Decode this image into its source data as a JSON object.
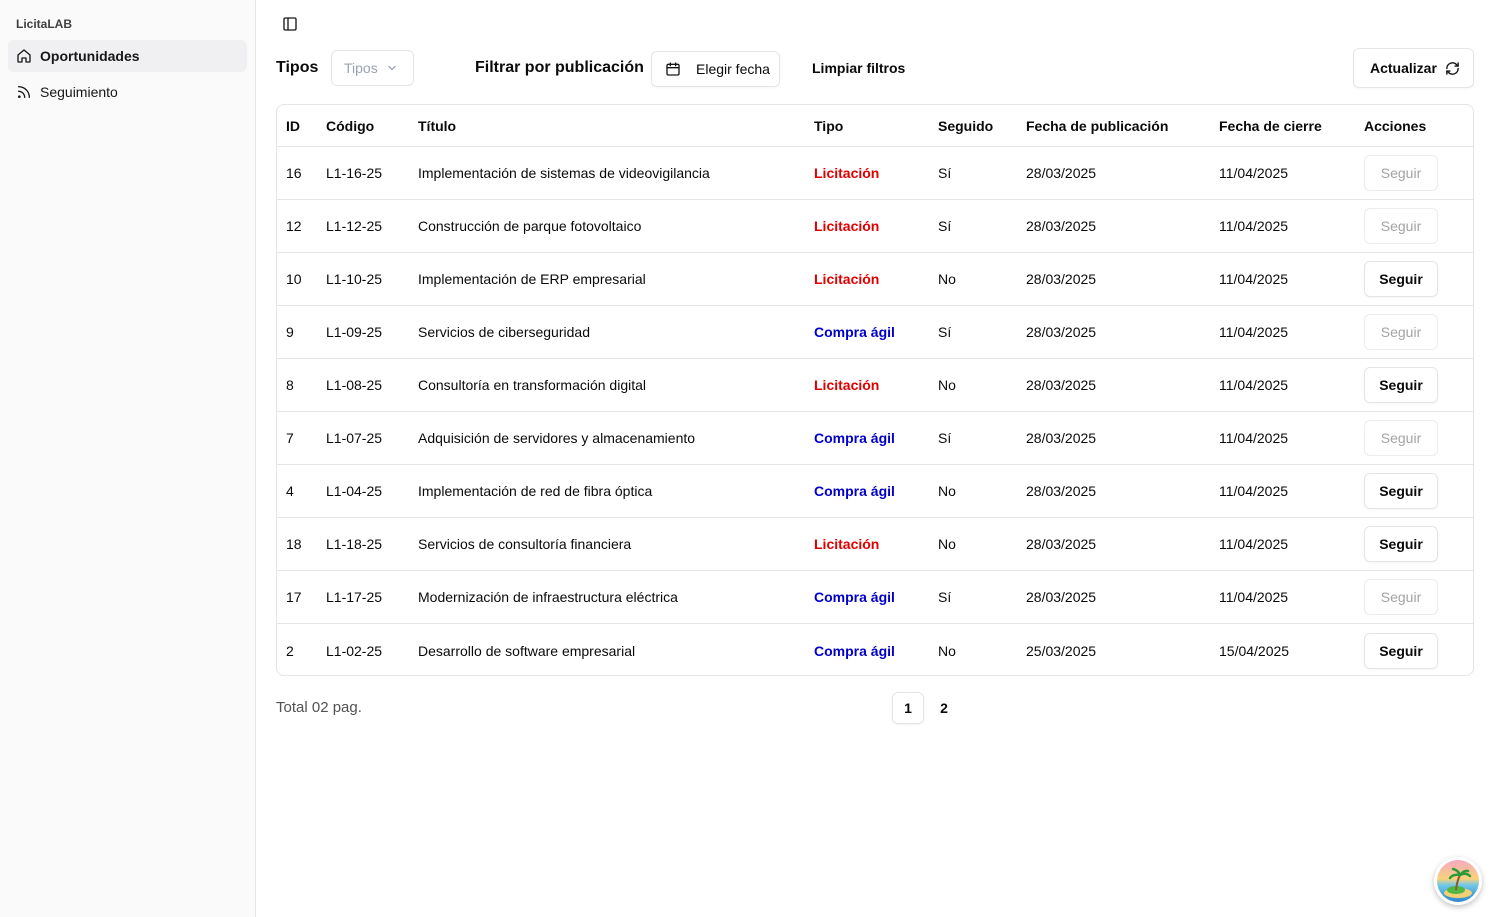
{
  "app": {
    "brand": "LicitaLAB"
  },
  "sidebar": {
    "items": [
      {
        "label": "Oportunidades",
        "icon": "home-icon",
        "active": true
      },
      {
        "label": "Seguimiento",
        "icon": "rss-icon",
        "active": false
      }
    ]
  },
  "filters": {
    "tipos_label": "Tipos",
    "tipos_placeholder": "Tipos",
    "publicacion_label": "Filtrar por publicación",
    "date_button": "Elegir fecha",
    "clear_button": "Limpiar filtros",
    "refresh_button": "Actualizar"
  },
  "table": {
    "headers": [
      "ID",
      "Código",
      "Título",
      "Tipo",
      "Seguido",
      "Fecha de publicación",
      "Fecha de cierre",
      "Acciones"
    ],
    "rows": [
      {
        "id": "16",
        "codigo": "L1-16-25",
        "titulo": "Implementación de sistemas de videovigilancia",
        "tipo": "Licitación",
        "seguido": "Sí",
        "publicacion": "28/03/2025",
        "cierre": "11/04/2025",
        "accion": "Seguir"
      },
      {
        "id": "12",
        "codigo": "L1-12-25",
        "titulo": "Construcción de parque fotovoltaico",
        "tipo": "Licitación",
        "seguido": "Sí",
        "publicacion": "28/03/2025",
        "cierre": "11/04/2025",
        "accion": "Seguir"
      },
      {
        "id": "10",
        "codigo": "L1-10-25",
        "titulo": "Implementación de ERP empresarial",
        "tipo": "Licitación",
        "seguido": "No",
        "publicacion": "28/03/2025",
        "cierre": "11/04/2025",
        "accion": "Seguir"
      },
      {
        "id": "9",
        "codigo": "L1-09-25",
        "titulo": "Servicios de ciberseguridad",
        "tipo": "Compra ágil",
        "seguido": "Sí",
        "publicacion": "28/03/2025",
        "cierre": "11/04/2025",
        "accion": "Seguir"
      },
      {
        "id": "8",
        "codigo": "L1-08-25",
        "titulo": "Consultoría en transformación digital",
        "tipo": "Licitación",
        "seguido": "No",
        "publicacion": "28/03/2025",
        "cierre": "11/04/2025",
        "accion": "Seguir"
      },
      {
        "id": "7",
        "codigo": "L1-07-25",
        "titulo": "Adquisición de servidores y almacenamiento",
        "tipo": "Compra ágil",
        "seguido": "Sí",
        "publicacion": "28/03/2025",
        "cierre": "11/04/2025",
        "accion": "Seguir"
      },
      {
        "id": "4",
        "codigo": "L1-04-25",
        "titulo": "Implementación de red de fibra óptica",
        "tipo": "Compra ágil",
        "seguido": "No",
        "publicacion": "28/03/2025",
        "cierre": "11/04/2025",
        "accion": "Seguir"
      },
      {
        "id": "18",
        "codigo": "L1-18-25",
        "titulo": "Servicios de consultoría financiera",
        "tipo": "Licitación",
        "seguido": "No",
        "publicacion": "28/03/2025",
        "cierre": "11/04/2025",
        "accion": "Seguir"
      },
      {
        "id": "17",
        "codigo": "L1-17-25",
        "titulo": "Modernización de infraestructura eléctrica",
        "tipo": "Compra ágil",
        "seguido": "Sí",
        "publicacion": "28/03/2025",
        "cierre": "11/04/2025",
        "accion": "Seguir"
      },
      {
        "id": "2",
        "codigo": "L1-02-25",
        "titulo": "Desarrollo de software empresarial",
        "tipo": "Compra ágil",
        "seguido": "No",
        "publicacion": "25/03/2025",
        "cierre": "15/04/2025",
        "accion": "Seguir"
      }
    ]
  },
  "pagination": {
    "total_label": "Total 02 pag.",
    "pages": [
      "1",
      "2"
    ],
    "current": "1"
  },
  "colors": {
    "licitacion": "#e00000",
    "compra_agil": "#0000cc",
    "border": "#e5e5e5",
    "sidebar_bg": "#fafafa"
  }
}
